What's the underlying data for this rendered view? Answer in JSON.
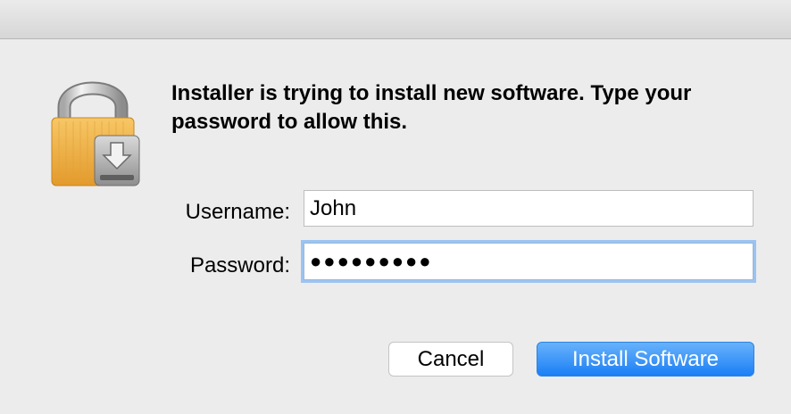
{
  "dialog": {
    "message": "Installer is trying to install new software. Type your password to allow this.",
    "icon": "lock-with-installer-icon",
    "accent_color": "#1b7ff5"
  },
  "form": {
    "username_label": "Username:",
    "username_value": "John",
    "password_label": "Password:",
    "password_value": "●●●●●●●●●"
  },
  "buttons": {
    "cancel_label": "Cancel",
    "install_label": "Install Software"
  }
}
